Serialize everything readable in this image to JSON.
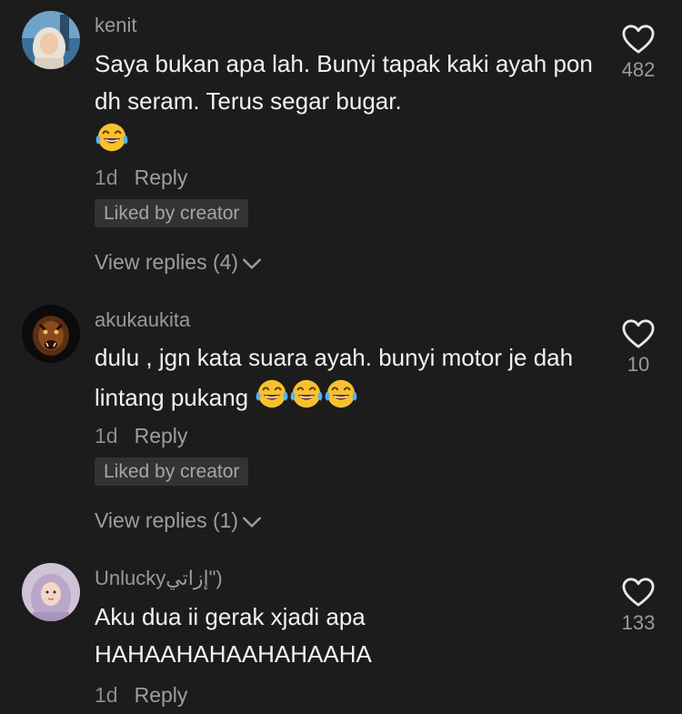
{
  "comments": [
    {
      "username": "kenit",
      "text": "Saya bukan apa lah. Bunyi tapak kaki ayah pon dh seram. Terus segar bugar.",
      "emoji_count": 1,
      "time": "1d",
      "reply_label": "Reply",
      "badge": "Liked by creator",
      "view_replies": "View replies (4)",
      "likes": "482"
    },
    {
      "username": "akukaukita",
      "text": "dulu , jgn kata suara ayah. bunyi motor je dah lintang pukang",
      "emoji_count": 3,
      "time": "1d",
      "reply_label": "Reply",
      "badge": "Liked by creator",
      "view_replies": "View replies (1)",
      "likes": "10"
    },
    {
      "username": "Unluckyإزاتي\")",
      "text": "Aku dua ii gerak xjadi apa HAHAAHAHAAHAHAAHA",
      "time": "1d",
      "reply_label": "Reply",
      "likes": "133"
    }
  ],
  "icons": {
    "like": "heart-outline-icon",
    "emoji": "face-with-tears-of-joy-icon",
    "expand": "chevron-down-icon"
  },
  "colors": {
    "background": "#1c1c1c",
    "text": "#f2f2f2",
    "muted": "#9a9a9a",
    "badge_bg": "#333333",
    "emoji": "#f7c12e"
  }
}
